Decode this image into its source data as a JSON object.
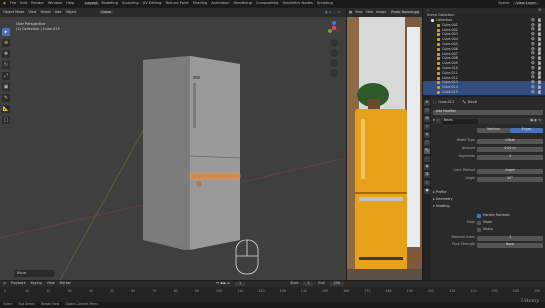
{
  "menubar": {
    "items": [
      "File",
      "Edit",
      "Render",
      "Window",
      "Help"
    ],
    "workspaces": [
      "Layout",
      "Modeling",
      "Sculpting",
      "UV Editing",
      "Texture Paint",
      "Shading",
      "Animation",
      "Rendering",
      "Compositing",
      "Geometry Nodes",
      "Scripting"
    ],
    "active_workspace": "Layout",
    "scene": "Scene",
    "view_layer": "View Layer"
  },
  "viewport": {
    "header": [
      "Object Mode",
      "View",
      "Select",
      "Add",
      "Object"
    ],
    "transform": "Global",
    "overlay_title": "User Perspective",
    "overlay_subtitle": "(1) Collection | Cube.013",
    "last_op": "Move"
  },
  "image_editor": {
    "header": [
      "View",
      "View",
      "Image"
    ],
    "image_name": "Photo Texture.jpg"
  },
  "outliner": {
    "root": "Scene Collection",
    "collection": "Collection",
    "items": [
      {
        "name": "Cube.001",
        "selected": false
      },
      {
        "name": "Cube.002",
        "selected": false
      },
      {
        "name": "Cube.003",
        "selected": false
      },
      {
        "name": "Cube.004",
        "selected": false
      },
      {
        "name": "Cube.005",
        "selected": false
      },
      {
        "name": "Cube.006",
        "selected": false
      },
      {
        "name": "Cube.007",
        "selected": false
      },
      {
        "name": "Cube.008",
        "selected": false
      },
      {
        "name": "Cube.009",
        "selected": false
      },
      {
        "name": "Cube.010",
        "selected": false
      },
      {
        "name": "Cube.011",
        "selected": false
      },
      {
        "name": "Cube.012",
        "selected": false
      },
      {
        "name": "Cube.013",
        "selected": true
      },
      {
        "name": "Cube.014",
        "selected": true
      },
      {
        "name": "Cube.015",
        "selected": true
      }
    ]
  },
  "properties": {
    "object_name": "Cube.013",
    "modifier_tab": "Bevel",
    "add_modifier": "Add Modifier",
    "modifier_name": "Bevel",
    "toggle_vertices": "Vertices",
    "toggle_edges": "Edges",
    "rows": [
      {
        "label": "Width Type",
        "value": "Offset"
      },
      {
        "label": "Amount",
        "value": "0.02 m"
      },
      {
        "label": "Segments",
        "value": "3"
      },
      {
        "label": "Limit Method",
        "value": "Angle"
      },
      {
        "label": "Angle",
        "value": "30°"
      }
    ],
    "sections": [
      "Profile",
      "Geometry",
      "Shading"
    ],
    "harden_normals": "Harden Normals",
    "mark_seam": "Seam",
    "mark_sharp": "Sharp",
    "mark_label": "Mark",
    "material_index_label": "Material Index",
    "material_index": "-1",
    "face_strength_label": "Face Strength",
    "face_strength": "None"
  },
  "timeline": {
    "header": [
      "Playback",
      "Keying",
      "View",
      "Marker"
    ],
    "frame_labels": [
      "0",
      "10",
      "20",
      "30",
      "40",
      "50",
      "60",
      "70",
      "80",
      "90",
      "100",
      "110",
      "120",
      "130",
      "140",
      "150",
      "160",
      "170",
      "180",
      "190",
      "200",
      "210",
      "220",
      "230",
      "240",
      "250"
    ],
    "current_frame": "1",
    "start_label": "Start",
    "start": "1",
    "end_label": "End",
    "end": "250"
  },
  "status": {
    "items": [
      "Select",
      "Box Select",
      "Rotate View",
      "Object Context Menu"
    ],
    "watermark": "Udemy"
  },
  "colors": {
    "accent": "#4772b3",
    "selection": "#334d80",
    "fridge": "#e8a21a"
  }
}
